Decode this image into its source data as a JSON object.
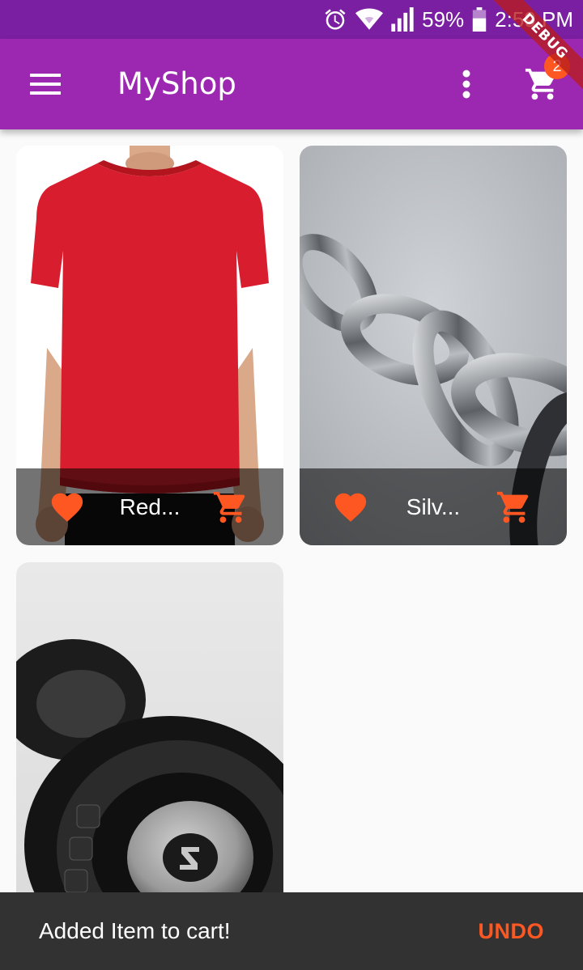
{
  "status_bar": {
    "battery_percent": "59%",
    "time": "2:59 PM",
    "icons": [
      "alarm-icon",
      "wifi-icon",
      "cell-signal-icon",
      "battery-icon"
    ]
  },
  "debug_banner": "DEBUG",
  "app_bar": {
    "title": "MyShop",
    "cart_count": "2",
    "icons": [
      "menu-icon",
      "more-vert-icon",
      "shopping-cart-icon"
    ]
  },
  "products": [
    {
      "title": "Red...",
      "favorite": true
    },
    {
      "title": "Silv...",
      "favorite": true
    },
    {
      "title": "",
      "favorite": false
    }
  ],
  "snackbar": {
    "message": "Added Item to cart!",
    "action": "UNDO"
  },
  "colors": {
    "status_bar": "#7b1fa2",
    "primary": "#9c27b0",
    "accent": "#ff5722",
    "background": "#fafafa",
    "snackbar": "#323232"
  }
}
